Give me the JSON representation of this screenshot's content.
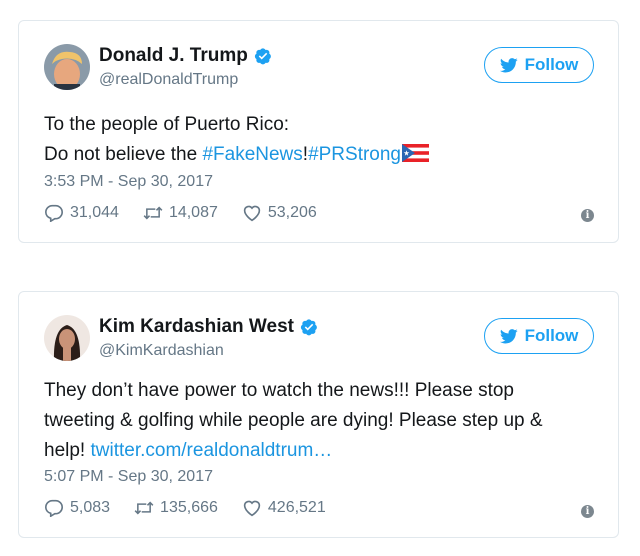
{
  "tweets": [
    {
      "name": "Donald J. Trump",
      "handle": "@realDonaldTrump",
      "follow_label": "Follow",
      "line1": "To the people of Puerto Rico:",
      "line2_prefix": "Do not believe the ",
      "hashtag1": "#FakeNews",
      "bang": "!",
      "hashtag2": "#PRStrong",
      "flag": "puerto-rico-flag",
      "time": "3:53 PM - Sep 30, 2017",
      "replies": "31,044",
      "retweets": "14,087",
      "likes": "53,206"
    },
    {
      "name": "Kim Kardashian West",
      "handle": "@KimKardashian",
      "follow_label": "Follow",
      "body": "They don’t have power to watch the news!!! Please stop tweeting & golfing while people are dying! Please step up & help! ",
      "link": "twitter.com/realdonaldtrum…",
      "time": "5:07 PM - Sep 30, 2017",
      "replies": "5,083",
      "retweets": "135,666",
      "likes": "426,521"
    }
  ],
  "colors": {
    "brand": "#1da1f2",
    "link": "#1b95e0",
    "muted": "#657786",
    "border": "#e1e8ed"
  }
}
